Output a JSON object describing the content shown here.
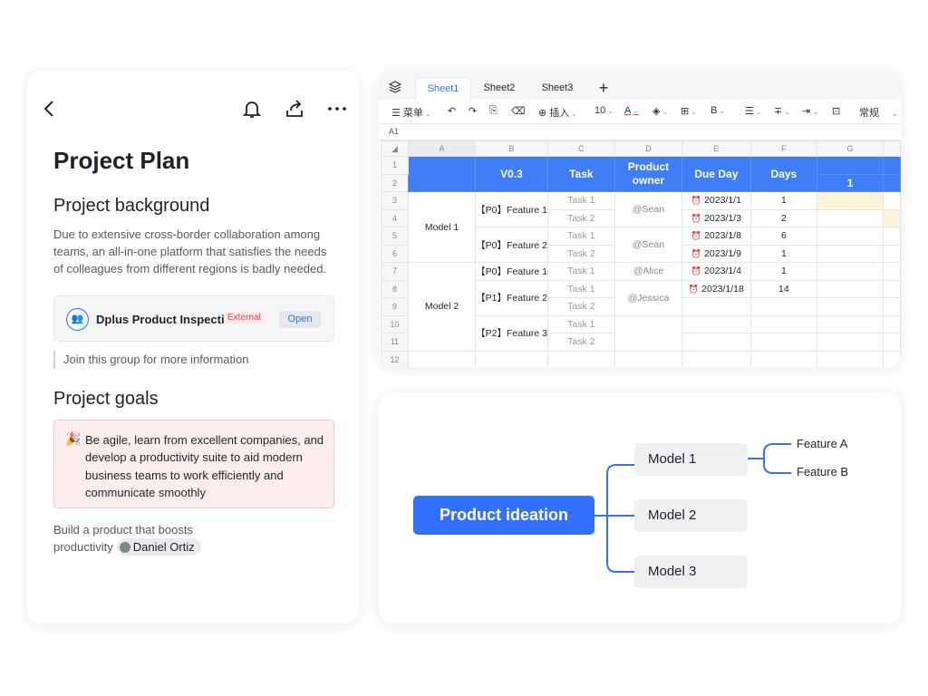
{
  "doc": {
    "title": "Project Plan",
    "background_heading": "Project background",
    "background_text": "Due to extensive cross-border collaboration among teams, an all-in-one platform that satisfies the needs of colleagues from different regions is badly needed.",
    "group": {
      "name": "Dplus Product Inspection",
      "badge": "External",
      "open_label": "Open"
    },
    "join_text": "Join this group for more information",
    "goals_heading": "Project goals",
    "goals_emoji": "🎉",
    "goals_text": "Be agile, learn from excellent companies, and develop a productivity suite to aid modern business teams to work efficiently and communicate smoothly",
    "build_text": "Build a product that boosts productivity",
    "mention": "Daniel Ortiz",
    "icons": [
      "back-icon",
      "bell-icon",
      "share-icon",
      "more-icon"
    ]
  },
  "sheet": {
    "tabs": [
      "Sheet1",
      "Sheet2",
      "Sheet3"
    ],
    "active_tab": "Sheet1",
    "add": "+",
    "toolbar": {
      "menu": "菜单",
      "insert": "插入",
      "font_size": "10",
      "text_color": "A",
      "bold": "B",
      "format": "常规"
    },
    "cell_ref": "A1",
    "columns": [
      "A",
      "B",
      "C",
      "D",
      "E",
      "F",
      "G"
    ],
    "rows": [
      "1",
      "2",
      "3",
      "4",
      "5",
      "6",
      "7",
      "8",
      "9",
      "10",
      "11",
      "12"
    ],
    "header": {
      "version": "V0.3",
      "task": "Task",
      "owner": "Product owner",
      "due": "Due Day",
      "days": "Days",
      "g2": "1"
    },
    "models": [
      "Model 1",
      "Model 2"
    ],
    "features": [
      "【P0】Feature 1",
      "【P0】Feature 2",
      "【P0】Feature 1",
      "【P1】Feature 2",
      "【P2】Feature 3"
    ],
    "tasks": [
      "Task 1",
      "Task 2",
      "Task 1",
      "Task 2",
      "Task 1",
      "Task 1",
      "Task 2",
      "Task 1",
      "Task 2"
    ],
    "owners": [
      "@Sean",
      "@Sean",
      "@Alice",
      "@Jessica"
    ],
    "due": [
      "2023/1/1",
      "2023/1/3",
      "2023/1/8",
      "2023/1/9",
      "2023/1/4",
      "2023/1/18"
    ],
    "days": [
      "1",
      "2",
      "6",
      "1",
      "1",
      "14"
    ],
    "colors": {
      "header": "#3f7ef7",
      "highlight": "#fdf3d6"
    }
  },
  "mindmap": {
    "root": "Product ideation",
    "nodes": [
      "Model 1",
      "Model 2",
      "Model 3"
    ],
    "leaves": [
      "Feature A",
      "Feature B"
    ],
    "color": "#3370ff"
  }
}
